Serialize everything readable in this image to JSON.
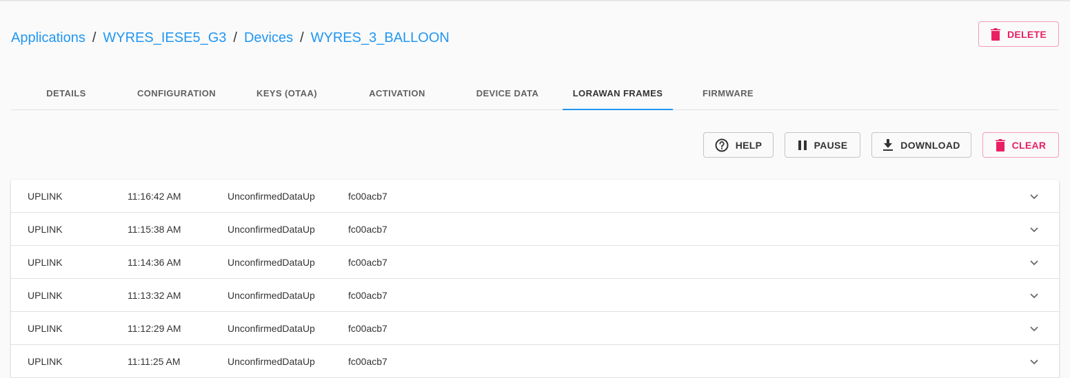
{
  "breadcrumb": [
    {
      "label": "Applications"
    },
    {
      "label": "WYRES_IESE5_G3"
    },
    {
      "label": "Devices"
    },
    {
      "label": "WYRES_3_BALLOON"
    }
  ],
  "breadcrumb_separator": "/",
  "header": {
    "delete_label": "DELETE"
  },
  "tabs": [
    {
      "label": "DETAILS"
    },
    {
      "label": "CONFIGURATION"
    },
    {
      "label": "KEYS (OTAA)"
    },
    {
      "label": "ACTIVATION"
    },
    {
      "label": "DEVICE DATA"
    },
    {
      "label": "LORAWAN FRAMES",
      "active": true
    },
    {
      "label": "FIRMWARE"
    }
  ],
  "toolbar": {
    "help_label": "HELP",
    "pause_label": "PAUSE",
    "download_label": "DOWNLOAD",
    "clear_label": "CLEAR"
  },
  "frames": [
    {
      "direction": "UPLINK",
      "time": "11:16:42 AM",
      "mtype": "UnconfirmedDataUp",
      "devaddr": "fc00acb7"
    },
    {
      "direction": "UPLINK",
      "time": "11:15:38 AM",
      "mtype": "UnconfirmedDataUp",
      "devaddr": "fc00acb7"
    },
    {
      "direction": "UPLINK",
      "time": "11:14:36 AM",
      "mtype": "UnconfirmedDataUp",
      "devaddr": "fc00acb7"
    },
    {
      "direction": "UPLINK",
      "time": "11:13:32 AM",
      "mtype": "UnconfirmedDataUp",
      "devaddr": "fc00acb7"
    },
    {
      "direction": "UPLINK",
      "time": "11:12:29 AM",
      "mtype": "UnconfirmedDataUp",
      "devaddr": "fc00acb7"
    },
    {
      "direction": "UPLINK",
      "time": "11:11:25 AM",
      "mtype": "UnconfirmedDataUp",
      "devaddr": "fc00acb7"
    }
  ],
  "icons": {
    "delete": "trash-icon",
    "help": "help-circle-icon",
    "pause": "pause-icon",
    "download": "download-icon",
    "clear": "trash-icon",
    "expand": "chevron-down-icon"
  },
  "colors": {
    "link": "#2196f3",
    "danger": "#e91e63",
    "tab_indicator": "#2196f3"
  }
}
